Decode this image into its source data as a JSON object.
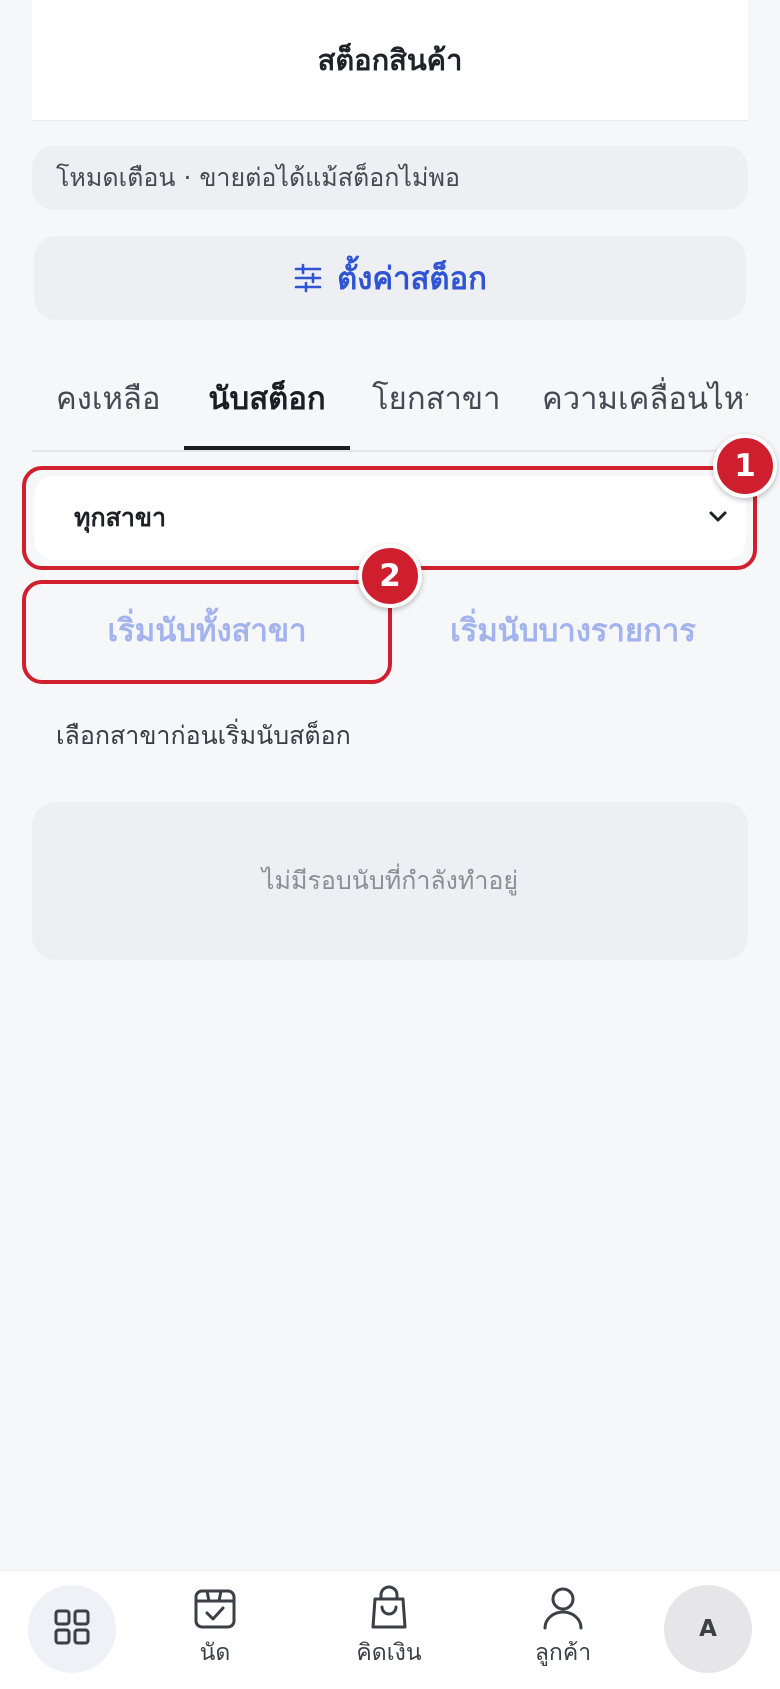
{
  "header": {
    "title": "สต็อกสินค้า"
  },
  "mode_banner": {
    "text": "โหมดเตือน · ขายต่อได้แม้สต็อกไม่พอ"
  },
  "settings_button": {
    "label": "ตั้งค่าสต็อก",
    "icon": "sliders-icon"
  },
  "tabs": [
    {
      "label": "คงเหลือ",
      "active": false
    },
    {
      "label": "นับสต็อก",
      "active": true
    },
    {
      "label": "โยกสาขา",
      "active": false
    },
    {
      "label": "ความเคลื่อนไหว",
      "active": false
    }
  ],
  "branch_select": {
    "value": "ทุกสาขา",
    "icon": "chevron-down-icon"
  },
  "annotations": {
    "badge_1": "1",
    "badge_2": "2"
  },
  "actions": {
    "start_all_label": "เริ่มนับทั้งสาขา",
    "start_some_label": "เริ่มนับบางรายการ"
  },
  "hint": "เลือกสาขาก่อนเริ่มนับสต็อก",
  "empty_state": {
    "text": "ไม่มีรอบนับที่กำลังทำอยู่"
  },
  "bottom_nav": {
    "home_icon": "grid-icon",
    "items": [
      {
        "label": "นัด",
        "icon": "calendar-check-icon"
      },
      {
        "label": "คิดเงิน",
        "icon": "shopping-bag-icon"
      },
      {
        "label": "ลูกค้า",
        "icon": "user-icon"
      }
    ],
    "avatar_initial": "A"
  },
  "colors": {
    "accent": "#2f55d4",
    "accent_disabled": "#a2b3ee",
    "annotation": "#d0202f",
    "background": "#f6f7f9",
    "card": "#eeeff2"
  }
}
